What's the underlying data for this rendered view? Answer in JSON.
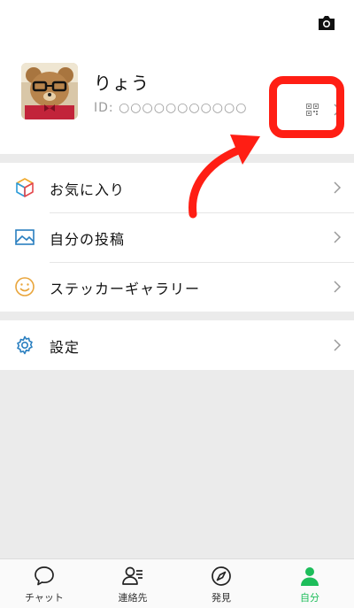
{
  "profile": {
    "name": "りょう",
    "id_label": "ID: ○○○○○○○○○○○"
  },
  "menu": {
    "favorites": "お気に入り",
    "my_posts": "自分の投稿",
    "sticker_gallery": "ステッカーギャラリー",
    "settings": "設定"
  },
  "tabs": {
    "chat": "チャット",
    "contacts": "連絡先",
    "discover": "発見",
    "me": "自分"
  },
  "colors": {
    "accent": "#1dbd5a",
    "annotation": "#ff1e14"
  }
}
